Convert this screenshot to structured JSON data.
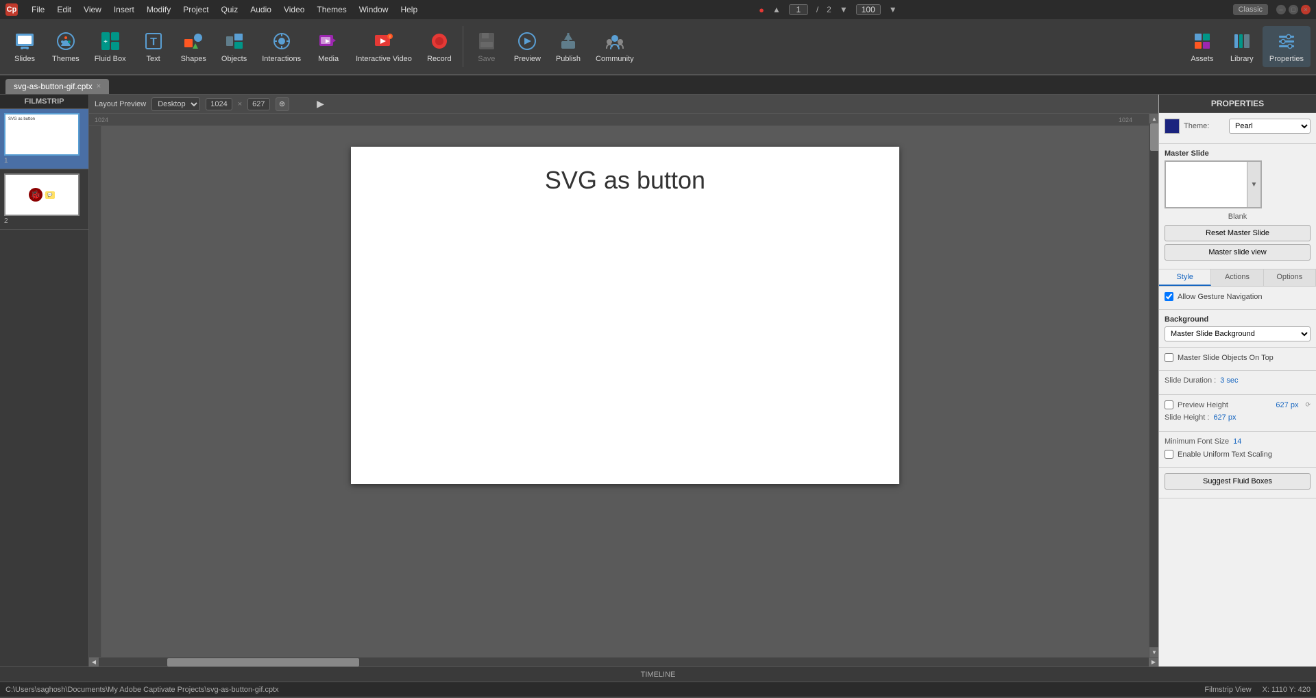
{
  "app": {
    "title": "Adobe Captivate",
    "icon_label": "Cp",
    "classic_badge": "Classic",
    "file_name": "svg-as-button-gif.cptx"
  },
  "title_bar": {
    "menus": [
      "File",
      "Edit",
      "View",
      "Insert",
      "Modify",
      "Project",
      "Quiz",
      "Audio",
      "Video",
      "Themes",
      "Window",
      "Help"
    ],
    "window_controls": [
      "–",
      "□",
      "×"
    ],
    "record_icon": "●",
    "page_input": "1",
    "page_separator": "/",
    "page_total": "2",
    "zoom_input": "100"
  },
  "toolbar": {
    "items": [
      {
        "id": "slides",
        "label": "Slides",
        "icon": "slides"
      },
      {
        "id": "themes",
        "label": "Themes",
        "icon": "themes"
      },
      {
        "id": "fluid-box",
        "label": "Fluid Box",
        "icon": "fluid-box"
      },
      {
        "id": "text",
        "label": "Text",
        "icon": "text"
      },
      {
        "id": "shapes",
        "label": "Shapes",
        "icon": "shapes"
      },
      {
        "id": "objects",
        "label": "Objects",
        "icon": "objects"
      },
      {
        "id": "interactions",
        "label": "Interactions",
        "icon": "interactions"
      },
      {
        "id": "media",
        "label": "Media",
        "icon": "media"
      },
      {
        "id": "interactive-video",
        "label": "Interactive Video",
        "icon": "interactive-video"
      },
      {
        "id": "record",
        "label": "Record",
        "icon": "record"
      },
      {
        "id": "save",
        "label": "Save",
        "icon": "save"
      },
      {
        "id": "preview",
        "label": "Preview",
        "icon": "preview"
      },
      {
        "id": "publish",
        "label": "Publish",
        "icon": "publish"
      },
      {
        "id": "community",
        "label": "Community",
        "icon": "community"
      }
    ],
    "right_icons": [
      {
        "id": "assets",
        "label": "Assets"
      },
      {
        "id": "library",
        "label": "Library"
      },
      {
        "id": "properties",
        "label": "Properties"
      }
    ]
  },
  "tab": {
    "name": "svg-as-button-gif.cptx",
    "close_btn": "×"
  },
  "filmstrip": {
    "header": "FILMSTRIP",
    "slides": [
      {
        "num": "1",
        "active": true,
        "label": "Slide 1"
      },
      {
        "num": "2",
        "active": false,
        "label": "Slide 2"
      }
    ]
  },
  "layout_strip": {
    "label": "Layout Preview",
    "dropdown_value": "Desktop",
    "width": "1024",
    "height": "627",
    "coord_left": "1024",
    "coord_right": "1024"
  },
  "canvas": {
    "slide_title": "SVG as button"
  },
  "properties": {
    "header": "PROPERTIES",
    "color_box_hex": "#1565C0",
    "theme_label": "Theme:",
    "theme_value": "Pearl",
    "master_slide_label": "Master Slide",
    "master_slide_blank": "Blank",
    "btn_reset": "Reset Master Slide",
    "btn_master_view": "Master slide view",
    "tabs": [
      "Style",
      "Actions",
      "Options"
    ],
    "active_tab": "Style",
    "gesture_nav_label": "Allow Gesture Navigation",
    "gesture_nav_checked": true,
    "background_label": "Background",
    "background_value": "Master Slide Background",
    "master_objects_label": "Master Slide Objects On Top",
    "master_objects_checked": false,
    "slide_duration_label": "Slide Duration :",
    "slide_duration_value": "3 sec",
    "preview_height_label": "Preview Height",
    "preview_height_value": "627 px",
    "preview_height_checked": false,
    "slide_height_label": "Slide Height :",
    "slide_height_value": "627 px",
    "min_font_label": "Minimum Font Size",
    "min_font_value": "14",
    "uniform_scaling_label": "Enable Uniform Text Scaling",
    "uniform_scaling_checked": false,
    "suggest_btn": "Suggest Fluid Boxes"
  },
  "timeline": {
    "label": "TIMELINE"
  },
  "status_bar": {
    "path": "C:\\Users\\saghosh\\Documents\\My Adobe Captivate Projects\\svg-as-button-gif.cptx",
    "view": "Filmstrip View",
    "coords": "X: 1110 Y: 420"
  }
}
